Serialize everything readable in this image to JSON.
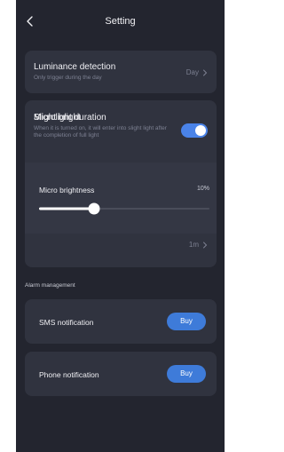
{
  "header": {
    "title": "Setting"
  },
  "luminance": {
    "label": "Luminance detection",
    "subtitle": "Only trigger during the day",
    "value": "Day"
  },
  "slight_bright": {
    "label": "Slight bright",
    "description": "When it is turned on, it will enter into slight light after the completion of full light",
    "enabled": true
  },
  "micro_brightness": {
    "label": "Micro brightness",
    "value_text": "10%",
    "value": 0.1
  },
  "microlight_duration": {
    "label": "Microlight duration",
    "value": "1m"
  },
  "alarm": {
    "section_title": "Alarm management",
    "sms": {
      "label": "SMS notification",
      "button": "Buy"
    },
    "phone": {
      "label": "Phone notification",
      "button": "Buy"
    }
  },
  "colors": {
    "background": "#23252f",
    "card": "#30333f",
    "accent": "#4a83e8"
  }
}
